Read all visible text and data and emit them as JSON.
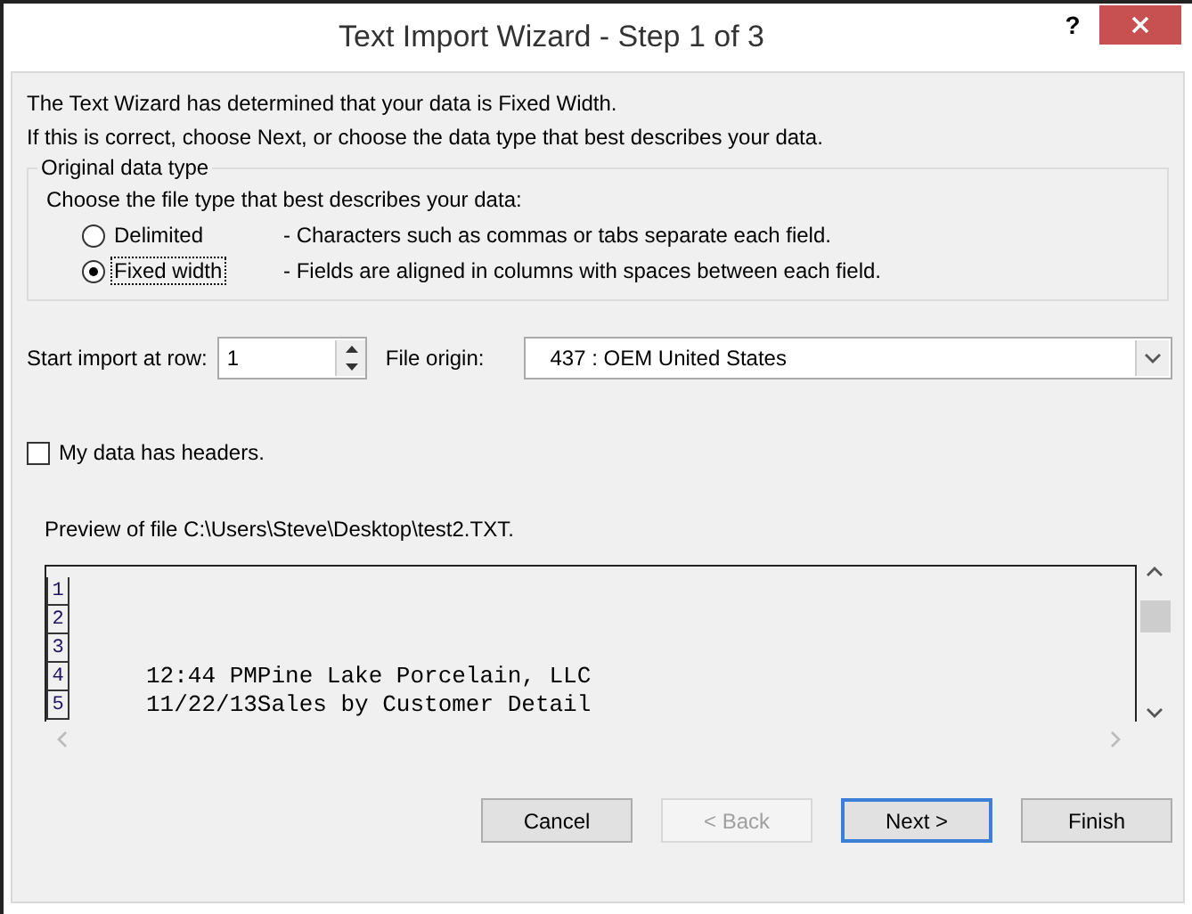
{
  "window": {
    "title": "Text Import Wizard - Step 1 of 3",
    "help": "?"
  },
  "intro": [
    "The Text Wizard has determined that your data is Fixed Width.",
    "If this is correct, choose Next, or choose the data type that best describes your data."
  ],
  "data_type_group": {
    "legend": "Original data type",
    "prompt": "Choose the file type that best describes your data:",
    "options": [
      {
        "label": "Delimited",
        "description": "- Characters such as commas or tabs separate each field.",
        "selected": false
      },
      {
        "label": "Fixed width",
        "description": "- Fields are aligned in columns with spaces between each field.",
        "selected": true
      }
    ]
  },
  "start_row": {
    "label": "Start import at row:",
    "value": "1"
  },
  "file_origin": {
    "label": "File origin:",
    "value": "437 : OEM United States"
  },
  "headers_checkbox": {
    "label": "My data has headers.",
    "checked": false
  },
  "preview": {
    "label": "Preview of file C:\\Users\\Steve\\Desktop\\test2.TXT.",
    "rows": [
      {
        "number": "1",
        "text": ""
      },
      {
        "number": "2",
        "text": ""
      },
      {
        "number": "3",
        "text": ""
      },
      {
        "number": "4",
        "text": "     12:44 PMPine Lake Porcelain, LLC"
      },
      {
        "number": "5",
        "text": "     11/22/13Sales by Customer Detail"
      }
    ]
  },
  "buttons": [
    {
      "label": "Cancel",
      "kind": "normal"
    },
    {
      "label": "< Back",
      "kind": "disabled"
    },
    {
      "label": "Next >",
      "kind": "default"
    },
    {
      "label": "Finish",
      "kind": "normal"
    }
  ]
}
